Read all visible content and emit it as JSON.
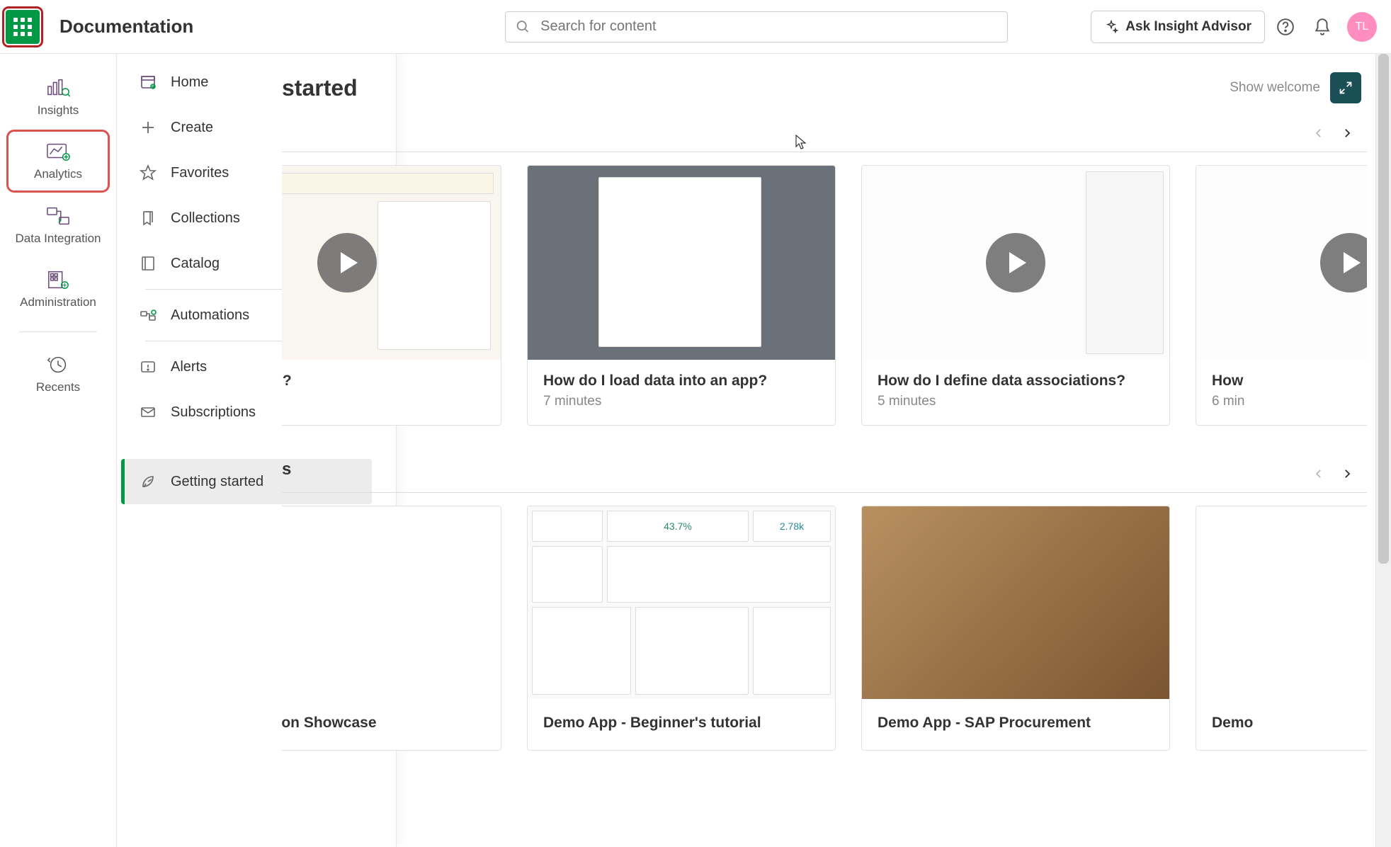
{
  "header": {
    "title": "Documentation",
    "search_placeholder": "Search for content",
    "ask_advisor_label": "Ask Insight Advisor",
    "avatar_initials": "TL"
  },
  "rail": {
    "items": [
      {
        "label": "Insights"
      },
      {
        "label": "Analytics"
      },
      {
        "label": "Data Integration"
      },
      {
        "label": "Administration"
      },
      {
        "label": "Recents"
      }
    ]
  },
  "flyout": {
    "items": [
      {
        "label": "Home"
      },
      {
        "label": "Create"
      },
      {
        "label": "Favorites"
      },
      {
        "label": "Collections"
      },
      {
        "label": "Catalog"
      },
      {
        "label": "Automations"
      },
      {
        "label": "Alerts"
      },
      {
        "label": "Subscriptions"
      },
      {
        "label": "Getting started"
      }
    ]
  },
  "main": {
    "page_title_partial": "started",
    "show_welcome": "Show welcome",
    "video_cards": [
      {
        "title_partial": "ate an app?"
      },
      {
        "title": "How do I load data into an app?",
        "sub": "7 minutes"
      },
      {
        "title": "How do I define data associations?",
        "sub": "5 minutes"
      },
      {
        "title_partial": "How",
        "sub_partial": "6 min"
      }
    ],
    "section2_label_partial": "s",
    "app_cards": [
      {
        "title": "Visualization Showcase"
      },
      {
        "title": "Demo App - Beginner's tutorial"
      },
      {
        "title": "Demo App - SAP Procurement"
      },
      {
        "title_partial": "Demo"
      }
    ]
  }
}
